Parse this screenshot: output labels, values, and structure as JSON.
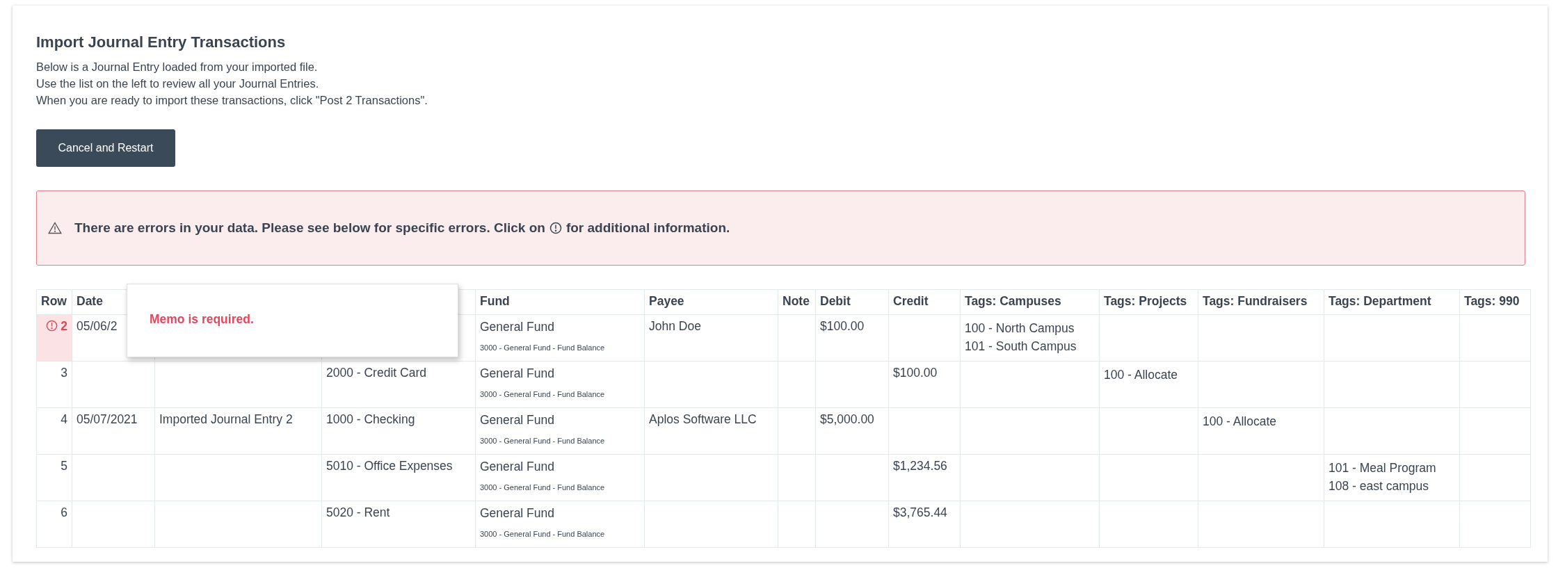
{
  "title": "Import Journal Entry Transactions",
  "description": [
    "Below is a Journal Entry loaded from your imported file.",
    "Use the list on the left to review all your Journal Entries.",
    "When you are ready to import these transactions, click \"Post 2 Transactions\"."
  ],
  "cancel_button": "Cancel and Restart",
  "error_banner": {
    "text_before": "There are errors in your data. Please see below for specific errors. Click on",
    "text_after": "for additional information."
  },
  "tooltip": "Memo is required.",
  "table": {
    "columns_left": [
      "Row",
      "Date"
    ],
    "columns_right": [
      "Fund",
      "Payee",
      "Note",
      "Debit",
      "Credit",
      "Tags: Campuses",
      "Tags: Projects",
      "Tags: Fundraisers",
      "Tags: Department",
      "Tags: 990"
    ],
    "rows": [
      {
        "row": "2",
        "error": true,
        "date": "05/06/2",
        "fund": "General Fund",
        "fund_account": "3000 - General Fund - Fund Balance",
        "payee": "John Doe",
        "debit": "$100.00",
        "campuses": [
          "100 - North Campus",
          "101 - South Campus"
        ]
      },
      {
        "row": "3",
        "error": false,
        "account": "2000 - Credit Card",
        "fund": "General Fund",
        "fund_account": "3000 - General Fund - Fund Balance",
        "credit": "$100.00",
        "projects": [
          "100 - Allocate"
        ]
      },
      {
        "row": "4",
        "error": false,
        "date": "05/07/2021",
        "memo": "Imported Journal Entry 2",
        "account": "1000 - Checking",
        "fund": "General Fund",
        "fund_account": "3000 - General Fund - Fund Balance",
        "payee": "Aplos Software LLC",
        "debit": "$5,000.00",
        "fundraisers": [
          "100 - Allocate"
        ]
      },
      {
        "row": "5",
        "error": false,
        "account": "5010 - Office Expenses",
        "fund": "General Fund",
        "fund_account": "3000 - General Fund - Fund Balance",
        "credit": "$1,234.56",
        "department": [
          "101 - Meal Program",
          "108 - east campus"
        ]
      },
      {
        "row": "6",
        "error": false,
        "account": "5020 - Rent",
        "fund": "General Fund",
        "fund_account": "3000 - General Fund - Fund Balance",
        "credit": "$3,765.44"
      }
    ]
  }
}
